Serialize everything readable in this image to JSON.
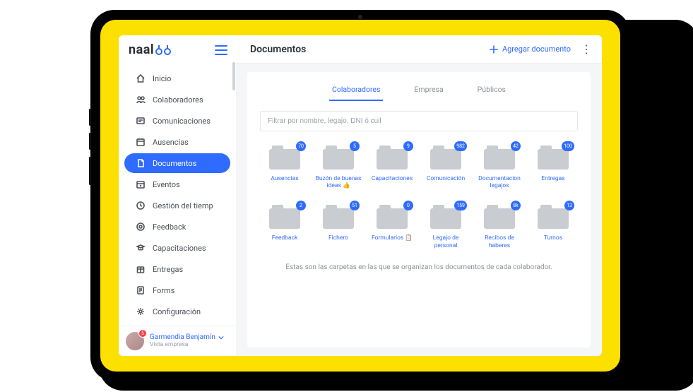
{
  "brand": {
    "name_part1": "naal",
    "name_part2_svg": "oo"
  },
  "sidebar": {
    "items": [
      {
        "id": "inicio",
        "label": "Inicio",
        "icon": "home-icon"
      },
      {
        "id": "colaboradores",
        "label": "Colaboradores",
        "icon": "people-icon"
      },
      {
        "id": "comunicaciones",
        "label": "Comunicaciones",
        "icon": "message-icon"
      },
      {
        "id": "ausencias",
        "label": "Ausencias",
        "icon": "calendar-icon"
      },
      {
        "id": "documentos",
        "label": "Documentos",
        "icon": "document-icon",
        "active": true
      },
      {
        "id": "eventos",
        "label": "Eventos",
        "icon": "event-icon"
      },
      {
        "id": "gestion-tiempo",
        "label": "Gestión del tiemp",
        "icon": "clock-icon"
      },
      {
        "id": "feedback",
        "label": "Feedback",
        "icon": "target-icon"
      },
      {
        "id": "capacitaciones",
        "label": "Capacitaciones",
        "icon": "graduation-icon"
      },
      {
        "id": "entregas",
        "label": "Entregas",
        "icon": "box-icon"
      },
      {
        "id": "forms",
        "label": "Forms",
        "icon": "form-icon"
      },
      {
        "id": "configuracion",
        "label": "Configuración",
        "icon": "gear-icon"
      }
    ]
  },
  "user": {
    "name": "Garmendia Benjamín",
    "role": "Vista empresa",
    "notifications": "5"
  },
  "header": {
    "title": "Documentos",
    "add_label": "Agregar documento"
  },
  "tabs": [
    {
      "id": "colaboradores",
      "label": "Colaboradores",
      "active": true
    },
    {
      "id": "empresa",
      "label": "Empresa"
    },
    {
      "id": "publicos",
      "label": "Públicos"
    }
  ],
  "filter": {
    "placeholder": "Filtrar por nombre, legajo, DNI ó cuil"
  },
  "folders": [
    {
      "label": "Ausencias",
      "count": "70"
    },
    {
      "label": "Buzón de buenas ideas 👍",
      "count": "5"
    },
    {
      "label": "Capacitaciones",
      "count": "9"
    },
    {
      "label": "Comunicación",
      "count": "982"
    },
    {
      "label": "Documentacion legajos",
      "count": "42"
    },
    {
      "label": "Entregas",
      "count": "100"
    },
    {
      "label": "Feedback",
      "count": "2"
    },
    {
      "label": "Fichero",
      "count": "51"
    },
    {
      "label": "Formularios 📋",
      "count": "0"
    },
    {
      "label": "Legajo de personal",
      "count": "159"
    },
    {
      "label": "Recibos de haberes",
      "count": "8k"
    },
    {
      "label": "Turnos",
      "count": "13"
    }
  ],
  "caption": "Estas son las carpetas en las que se organizan los documentos de cada colaborador."
}
